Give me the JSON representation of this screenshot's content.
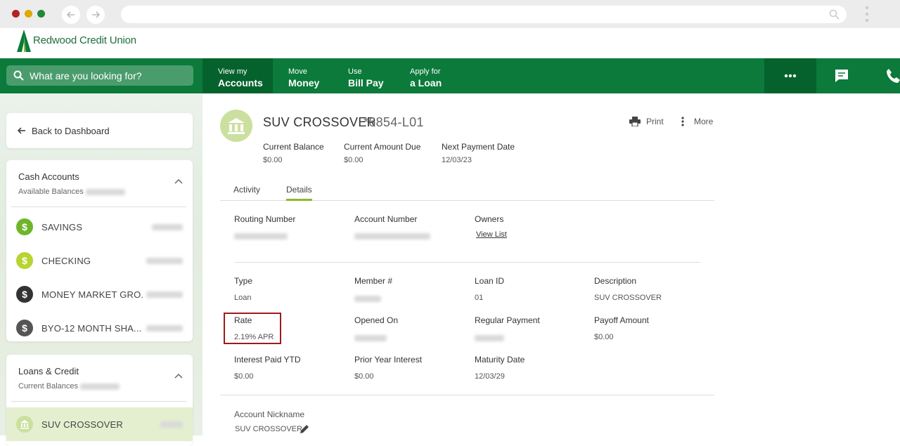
{
  "browser": {
    "dots": [
      "#c0392b",
      "#e0a800",
      "#1f8a3a"
    ]
  },
  "brand": {
    "name": "Redwood Credit Union",
    "color": "#0b7a3a"
  },
  "nav": {
    "search_placeholder": "What are you looking for?",
    "items": [
      {
        "small": "View my",
        "big": "Accounts"
      },
      {
        "small": "Move",
        "big": "Money"
      },
      {
        "small": "Use",
        "big": "Bill Pay"
      },
      {
        "small": "Apply for",
        "big": "a Loan"
      }
    ]
  },
  "sidebar": {
    "back_label": "Back to Dashboard",
    "cash": {
      "title": "Cash Accounts",
      "subtitle": "Available Balances",
      "accounts": [
        {
          "name": "SAVINGS",
          "color": "#6fb52c"
        },
        {
          "name": "CHECKING",
          "color": "#b7d430"
        },
        {
          "name": "MONEY MARKET GRO.",
          "color": "#333333"
        },
        {
          "name": "BYO-12 MONTH SHA...",
          "color": "#555555"
        }
      ]
    },
    "loans": {
      "title": "Loans & Credit",
      "subtitle": "Current Balances",
      "accounts": [
        {
          "name": "SUV CROSSOVER",
          "color": "#cbe09f"
        }
      ]
    }
  },
  "account": {
    "title": "SUV CROSSOVER",
    "number": "*6854-L01",
    "print_label": "Print",
    "more_label": "More",
    "summary": [
      {
        "label": "Current Balance",
        "value": "$0.00"
      },
      {
        "label": "Current Amount Due",
        "value": "$0.00"
      },
      {
        "label": "Next Payment Date",
        "value": "12/03/23"
      }
    ],
    "tabs": [
      "Activity",
      "Details"
    ],
    "routing": {
      "routing_label": "Routing Number",
      "account_label": "Account Number",
      "owners_label": "Owners",
      "owners_link": "View List"
    },
    "details": [
      {
        "label": "Type",
        "value": "Loan"
      },
      {
        "label": "Member #",
        "value": ""
      },
      {
        "label": "Loan ID",
        "value": "01"
      },
      {
        "label": "Description",
        "value": "SUV CROSSOVER"
      },
      {
        "label": "Rate",
        "value": "2.19% APR"
      },
      {
        "label": "Opened On",
        "value": ""
      },
      {
        "label": "Regular Payment",
        "value": ""
      },
      {
        "label": "Payoff Amount",
        "value": "$0.00"
      },
      {
        "label": "Interest Paid YTD",
        "value": "$0.00"
      },
      {
        "label": "Prior Year Interest",
        "value": "$0.00"
      },
      {
        "label": "Maturity Date",
        "value": "12/03/29"
      }
    ],
    "nickname_label": "Account Nickname",
    "nickname_value": "SUV CROSSOVER"
  }
}
